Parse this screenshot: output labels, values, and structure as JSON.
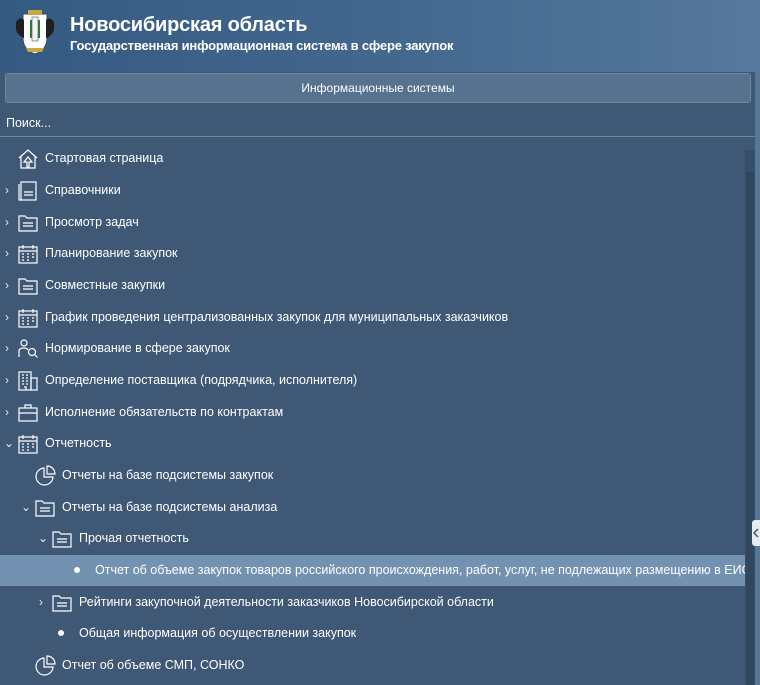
{
  "header": {
    "title": "Новосибирская область",
    "subtitle": "Государственная информационная система в сфере закупок"
  },
  "section_bar": {
    "label": "Информационные системы"
  },
  "search": {
    "placeholder": "Поиск..."
  },
  "tree": {
    "items": [
      {
        "label": "Стартовая страница",
        "icon": "home-icon"
      },
      {
        "label": "Справочники",
        "icon": "document-list-icon"
      },
      {
        "label": "Просмотр задач",
        "icon": "folder-icon"
      },
      {
        "label": "Планирование закупок",
        "icon": "calendar-icon"
      },
      {
        "label": "Совместные закупки",
        "icon": "folder-icon"
      },
      {
        "label": "График проведения централизованных закупок для муниципальных заказчиков",
        "icon": "calendar-icon"
      },
      {
        "label": "Нормирование в сфере закупок",
        "icon": "user-search-icon"
      },
      {
        "label": "Определение поставщика (подрядчика, исполнителя)",
        "icon": "building-icon"
      },
      {
        "label": "Исполнение обязательств по контрактам",
        "icon": "briefcase-icon"
      },
      {
        "label": "Отчетность",
        "icon": "calendar-icon"
      },
      {
        "label": "Отчеты на базе подсистемы закупок",
        "icon": "pie-chart-icon"
      },
      {
        "label": "Отчеты на базе подсистемы анализа",
        "icon": "folder-icon"
      },
      {
        "label": "Прочая отчетность",
        "icon": "folder-icon"
      },
      {
        "label": "Отчет об объеме закупок товаров российского происхождения, работ, услуг, не подлежащих размещению в ЕИС",
        "icon": "bullet"
      },
      {
        "label": "Рейтинги закупочной деятельности заказчиков Новосибирской области",
        "icon": "folder-icon"
      },
      {
        "label": "Общая информация об осуществлении закупок",
        "icon": "bullet"
      },
      {
        "label": "Отчет об объеме СМП, СОНКО",
        "icon": "pie-chart-icon"
      }
    ]
  }
}
